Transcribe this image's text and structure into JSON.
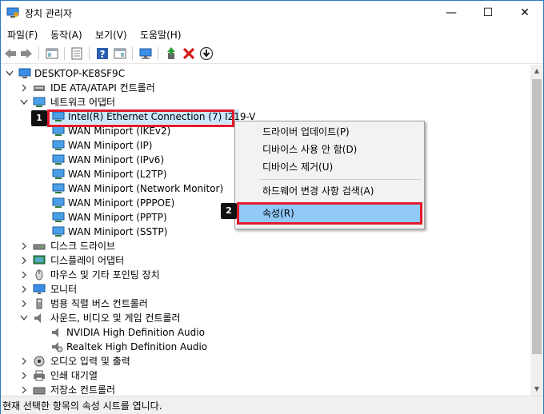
{
  "window": {
    "title": "장치 관리자",
    "minimize_glyph": "—",
    "maximize_glyph": "☐",
    "close_glyph": "✕"
  },
  "menu": [
    "파일(F)",
    "동작(A)",
    "보기(V)",
    "도움말(H)"
  ],
  "toolbar": {
    "icons": [
      "back-icon",
      "forward-icon",
      "show-hide-tree-icon",
      "properties-icon",
      "help-icon",
      "action-pane-icon",
      "monitor-icon",
      "update-driver-icon",
      "uninstall-icon",
      "download-icon"
    ]
  },
  "tree": {
    "root": "DESKTOP-KE8SF9C",
    "nodes": [
      {
        "label": "IDE ATA/ATAPI 컨트롤러",
        "expanded": false
      },
      {
        "label": "네트워크 어댑터",
        "expanded": true
      },
      {
        "label": "Intel(R) Ethernet Connection (7) I219-V",
        "child": true,
        "selected": true
      },
      {
        "label": "WAN Miniport (IKEv2)",
        "child": true
      },
      {
        "label": "WAN Miniport (IP)",
        "child": true
      },
      {
        "label": "WAN Miniport (IPv6)",
        "child": true
      },
      {
        "label": "WAN Miniport (L2TP)",
        "child": true
      },
      {
        "label": "WAN Miniport (Network Monitor)",
        "child": true
      },
      {
        "label": "WAN Miniport (PPPOE)",
        "child": true
      },
      {
        "label": "WAN Miniport (PPTP)",
        "child": true
      },
      {
        "label": "WAN Miniport (SSTP)",
        "child": true
      },
      {
        "label": "디스크 드라이브",
        "expanded": false
      },
      {
        "label": "디스플레이 어댑터",
        "expanded": false
      },
      {
        "label": "마우스 및 기타 포인팅 장치",
        "expanded": false
      },
      {
        "label": "모니터",
        "expanded": false
      },
      {
        "label": "범용 직렬 버스 컨트롤러",
        "expanded": false
      },
      {
        "label": "사운드, 비디오 및 게임 컨트롤러",
        "expanded": true
      },
      {
        "label": "NVIDIA High Definition Audio",
        "child": true
      },
      {
        "label": "Realtek High Definition Audio",
        "child": true
      },
      {
        "label": "오디오 입력 및 출력",
        "expanded": false
      },
      {
        "label": "인쇄 대기열",
        "expanded": false
      },
      {
        "label": "저장소 컨트롤러",
        "expanded": false
      }
    ]
  },
  "context_menu": {
    "items": [
      "드라이버 업데이트(P)",
      "디바이스 사용 안 함(D)",
      "디바이스 제거(U)",
      "하드웨어 변경 사항 검색(A)",
      "속성(R)"
    ],
    "highlighted_index": 4
  },
  "annotations": {
    "badge1": "1",
    "badge2": "2",
    "box_color": "#e21b2d"
  },
  "status": "현재 선택한 항목의 속성 시트를 엽니다.",
  "colors": {
    "accent": "#2b79c2",
    "selection": "#cce8ff",
    "menu_highlight": "#91c9f7"
  }
}
